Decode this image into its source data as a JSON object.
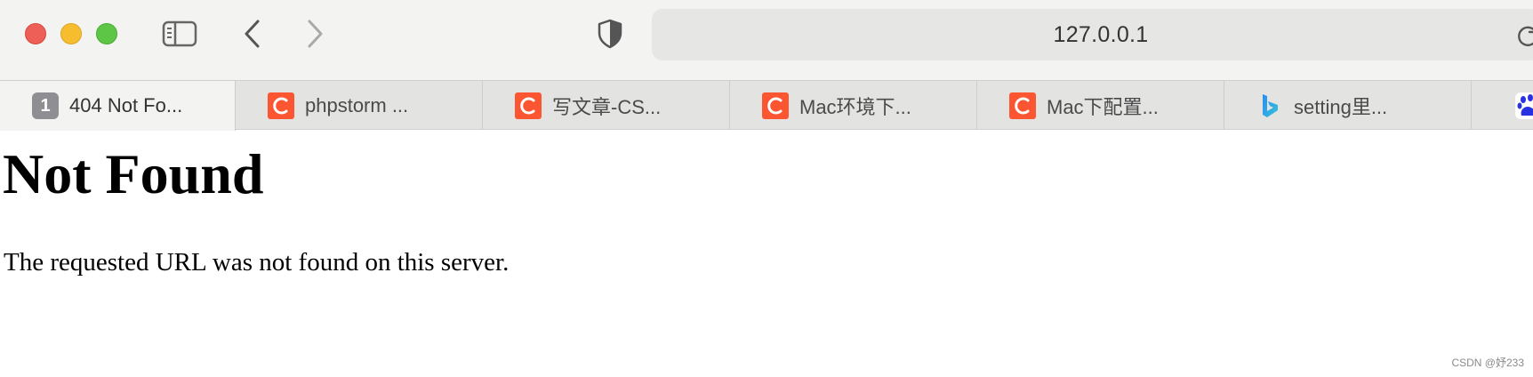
{
  "address_bar": {
    "url": "127.0.0.1"
  },
  "tabs": [
    {
      "icon": "number-badge-icon",
      "badge": "1",
      "title": "404 Not Fo...",
      "active": true
    },
    {
      "icon": "csdn-icon",
      "title": "phpstorm ...",
      "active": false
    },
    {
      "icon": "csdn-icon",
      "title": "写文章-CS...",
      "active": false
    },
    {
      "icon": "csdn-icon",
      "title": "Mac环境下...",
      "active": false
    },
    {
      "icon": "csdn-icon",
      "title": "Mac下配置...",
      "active": false
    },
    {
      "icon": "bing-icon",
      "title": "setting里...",
      "active": false
    },
    {
      "icon": "baidu-icon",
      "title": "",
      "active": false
    }
  ],
  "page": {
    "heading": "Not Found",
    "message": "The requested URL was not found on this server."
  },
  "watermark": "CSDN @妤233",
  "colors": {
    "toolbar_bg": "#f3f4f2",
    "tabbar_bg": "#e3e4e2",
    "csdn_red": "#fc5531",
    "close_red": "#ee5f57",
    "minimize_yellow": "#f6be2f",
    "zoom_green": "#5dc646"
  }
}
